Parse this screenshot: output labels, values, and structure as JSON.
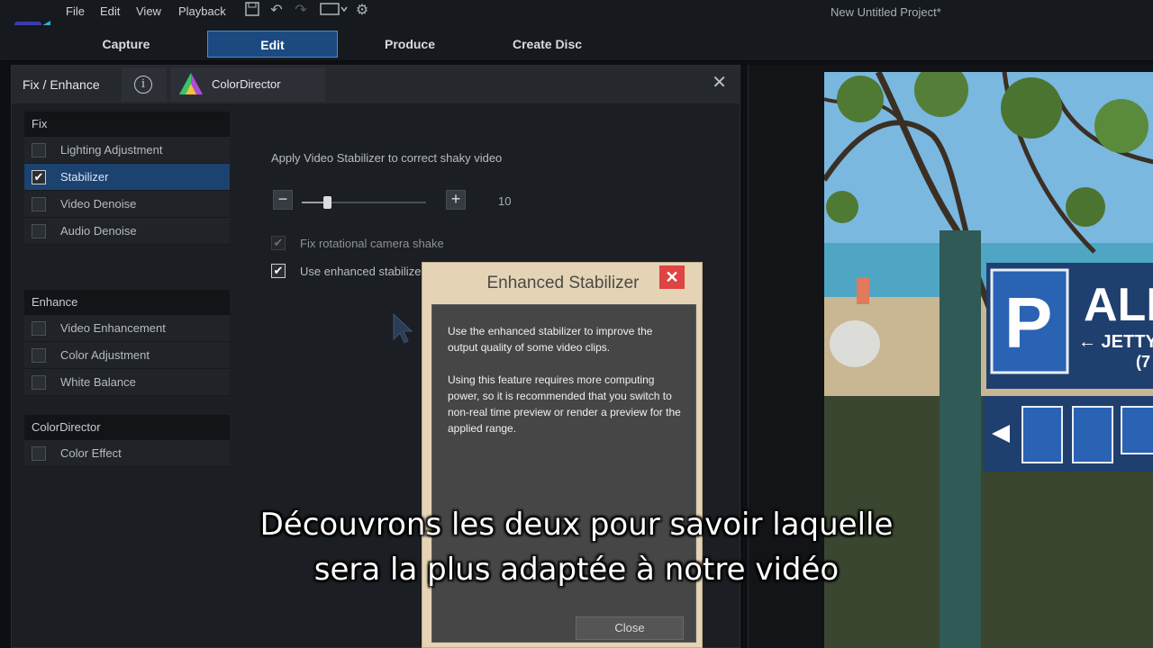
{
  "menu": {
    "items": [
      "File",
      "Edit",
      "View",
      "Playback"
    ],
    "project_title": "New Untitled Project*"
  },
  "mode_tabs": [
    {
      "label": "Capture",
      "active": false
    },
    {
      "label": "Edit",
      "active": true
    },
    {
      "label": "Produce",
      "active": false
    },
    {
      "label": "Create Disc",
      "active": false
    }
  ],
  "panel": {
    "title": "Fix / Enhance",
    "colordirector_label": "ColorDirector",
    "info_glyph": "i",
    "categories": [
      {
        "name": "Fix",
        "items": [
          {
            "label": "Lighting Adjustment",
            "checked": false,
            "selected": false
          },
          {
            "label": "Stabilizer",
            "checked": true,
            "selected": true
          },
          {
            "label": "Video Denoise",
            "checked": false,
            "selected": false
          },
          {
            "label": "Audio Denoise",
            "checked": false,
            "selected": false
          }
        ]
      },
      {
        "name": "Enhance",
        "items": [
          {
            "label": "Video Enhancement",
            "checked": false,
            "selected": false
          },
          {
            "label": "Color Adjustment",
            "checked": false,
            "selected": false
          },
          {
            "label": "White Balance",
            "checked": false,
            "selected": false
          }
        ]
      },
      {
        "name": "ColorDirector",
        "items": [
          {
            "label": "Color Effect",
            "checked": false,
            "selected": false
          }
        ]
      }
    ]
  },
  "stabilizer": {
    "description": "Apply Video Stabilizer to correct shaky video",
    "minus": "−",
    "plus": "+",
    "value": "10",
    "slider_fraction": 0.2,
    "fix_rotational_label": "Fix rotational camera shake",
    "fix_rotational_checked": true,
    "enhanced_label": "Use enhanced stabilizer",
    "enhanced_checked": true
  },
  "dialog": {
    "title": "Enhanced Stabilizer",
    "close_glyph": "✕",
    "paragraph1": "Use the enhanced stabilizer to improve the output quality of some video clips.",
    "paragraph2": "Using this feature requires more computing power, so it is recommended that you switch to non-real time preview or render a preview for the applied range.",
    "button": "Close"
  },
  "preview": {
    "sign_text": "ALL",
    "sign_sub": "← JETTY",
    "sign_num": "(7",
    "parking": "P"
  },
  "subtitle": {
    "line1": "Découvrons les deux pour savoir laquelle",
    "line2": "sera la plus adaptée à notre vidéo"
  },
  "colors": {
    "accent": "#1c4a80",
    "selected_item": "#1c4270",
    "dialog_close": "#e04343"
  }
}
